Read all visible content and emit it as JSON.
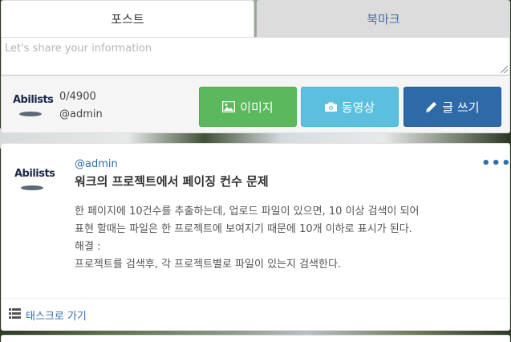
{
  "tabs": [
    {
      "label": "포스트",
      "active": true
    },
    {
      "label": "북마크",
      "active": false
    }
  ],
  "composer": {
    "placeholder": "Let's share your information",
    "value": "",
    "counter": "0/4900",
    "user_handle": "@admin",
    "logo_text": "Abilists",
    "buttons": {
      "image_label": "이미지",
      "video_label": "동영상",
      "write_label": "글 쓰기"
    }
  },
  "post": {
    "author": "@admin",
    "title": "워크의 프로젝트에서 페이징 컨수 문제",
    "body_lines": [
      "한 페이지에 10건수를 추출하는데, 업로드 파일이 있으면, 10 이상 검색이 되어",
      "표현 할때는 파일은 한 프로젝트에 보여지기 때문에 10개 이하로 표시가 된다.",
      "해결 :",
      "프로젝트를 검색후, 각 프로젝트별로 파일이 있는지 검색한다."
    ],
    "menu_glyph": "•••",
    "task_link_label": "태스크로 가기"
  },
  "colors": {
    "link_blue": "#2f6ea8",
    "green_button": "#5cb85c",
    "cyan_button": "#5bc0de",
    "navy_button": "#2e6aa8"
  },
  "icons": {
    "image_button": "picture-icon",
    "video_button": "camera-icon",
    "write_button": "pencil-icon",
    "task_link": "list-icon",
    "post_menu": "more-dots-icon"
  }
}
